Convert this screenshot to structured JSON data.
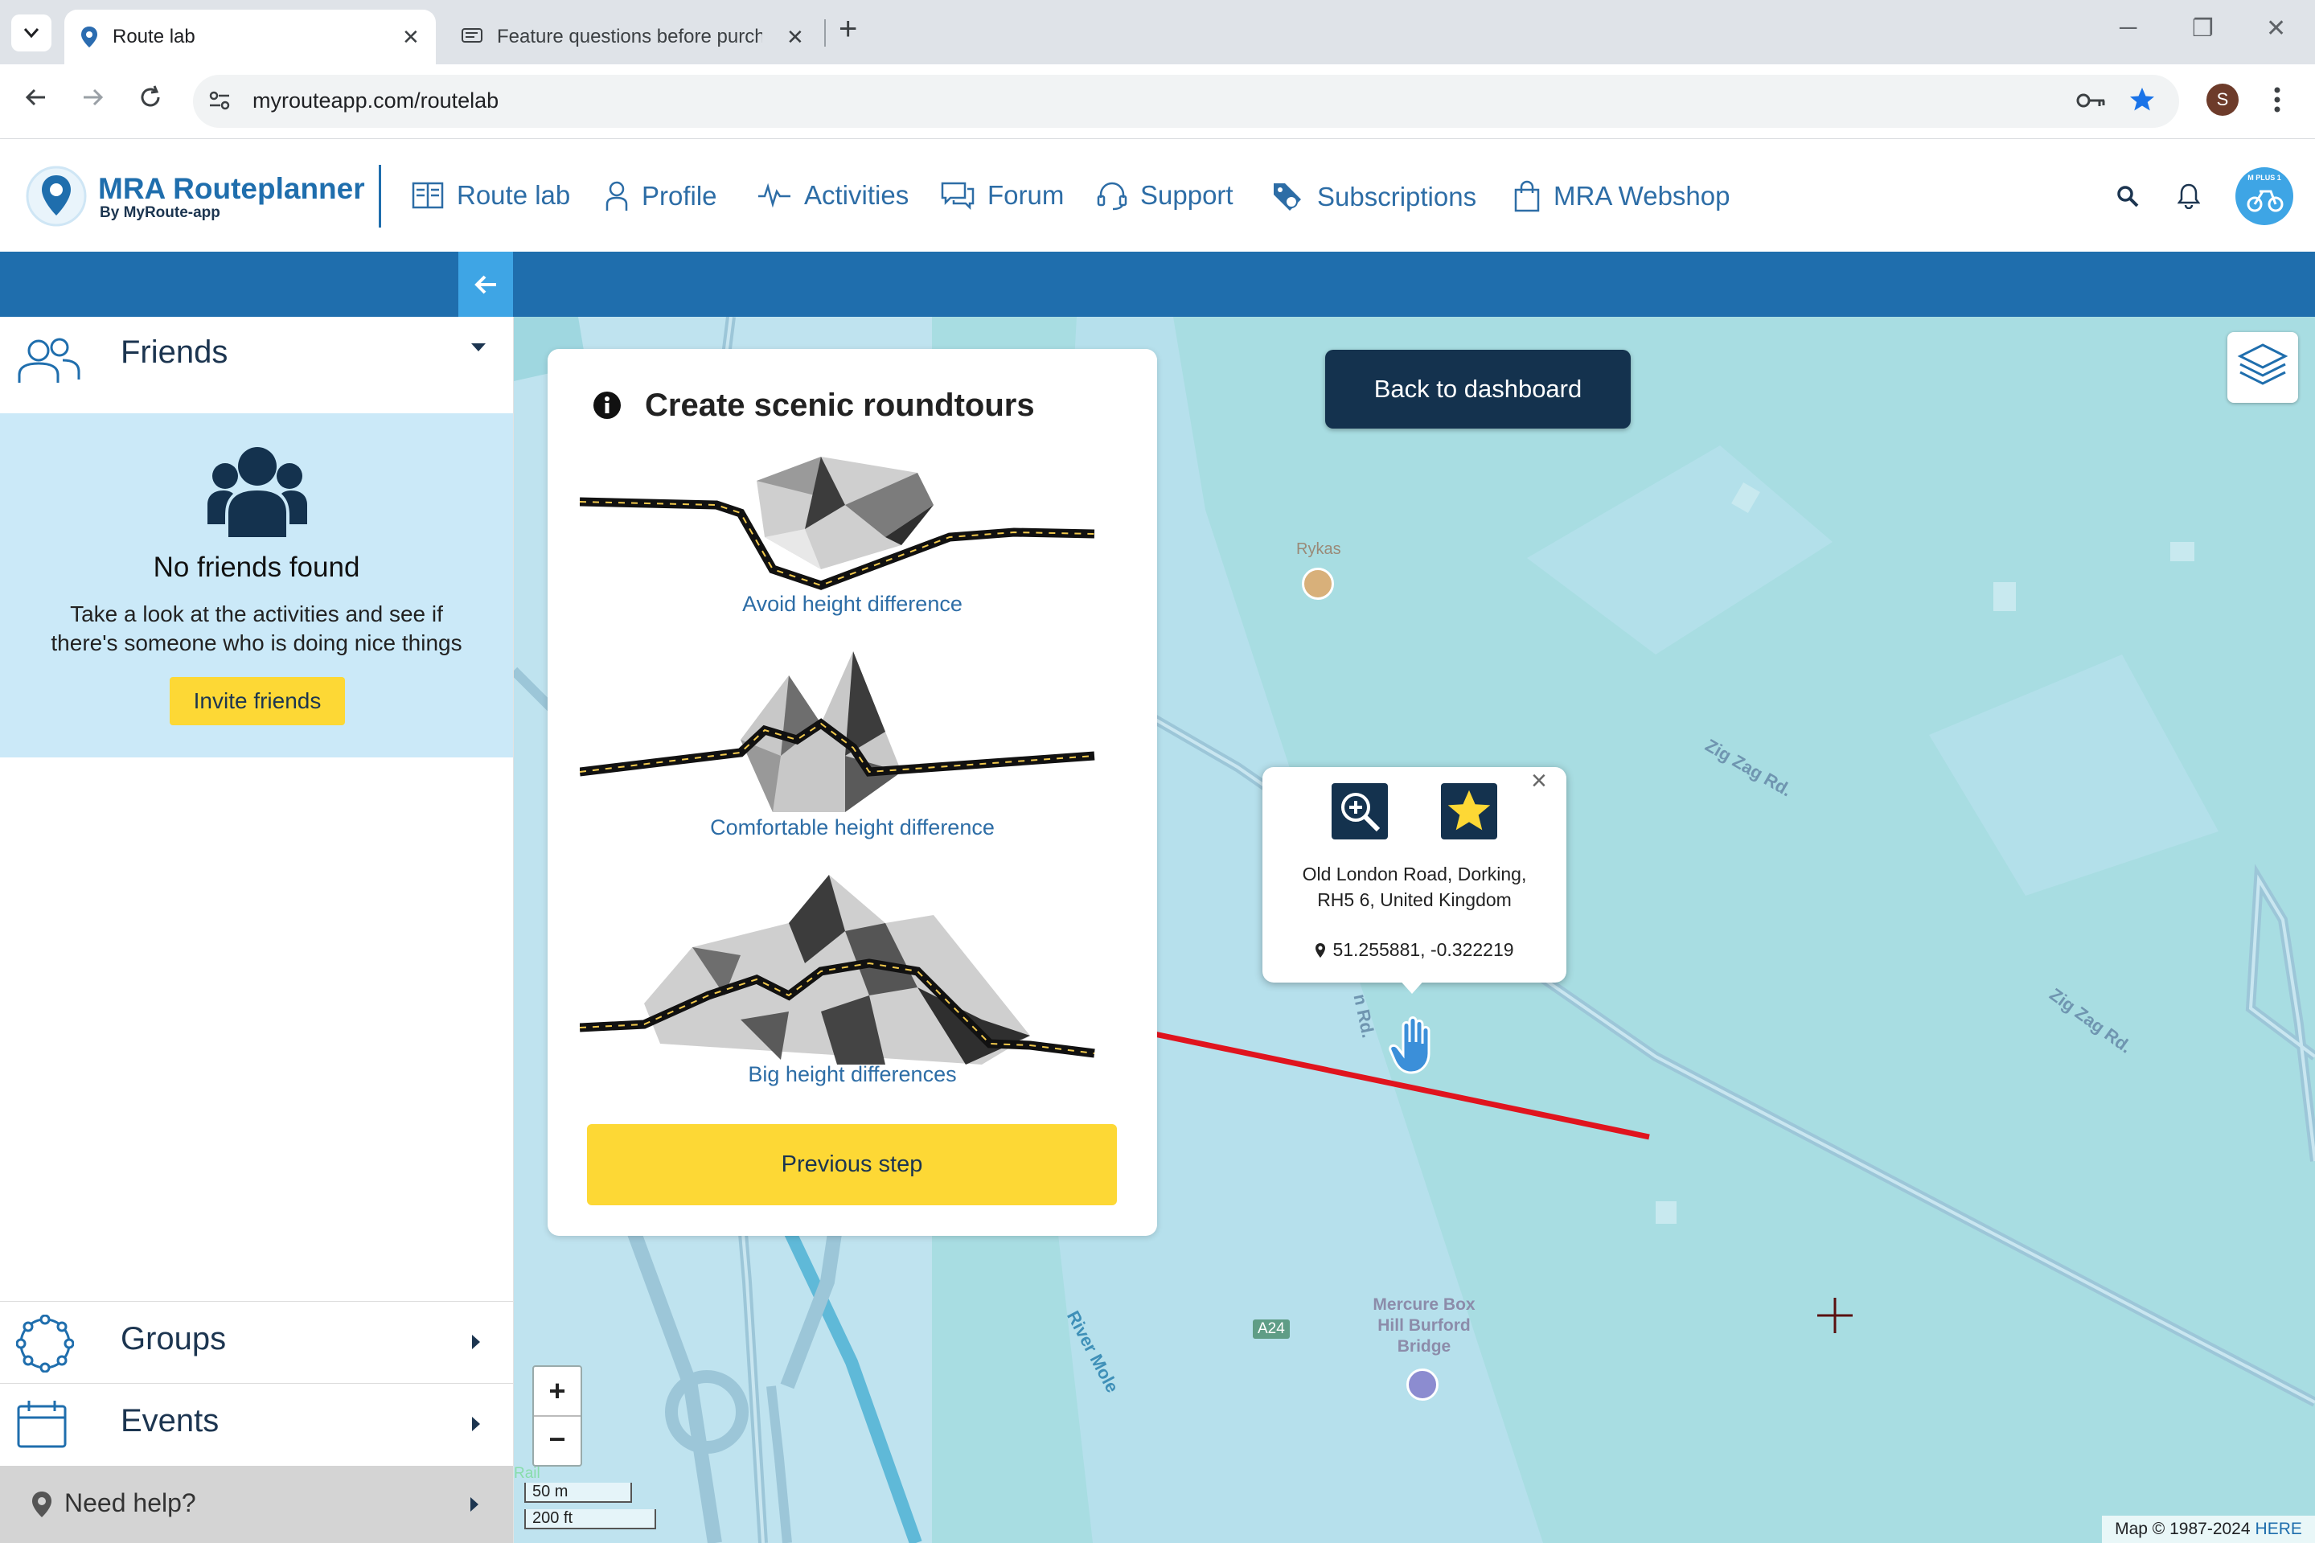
{
  "browser": {
    "tabs": [
      {
        "title": "Route lab",
        "close": "✕"
      },
      {
        "title": "Feature questions before purch",
        "close": "✕"
      }
    ],
    "new_tab": "+",
    "url": "myrouteapp.com/routelab",
    "profile_initial": "S",
    "window_controls": {
      "minimize": "─",
      "restore": "❐",
      "close": "✕"
    }
  },
  "app": {
    "logo": {
      "title": "MRA Routeplanner",
      "subtitle": "By MyRoute-app"
    },
    "nav": [
      {
        "label": "Route lab",
        "icon": "map-book-icon"
      },
      {
        "label": "Profile",
        "icon": "user-icon"
      },
      {
        "label": "Activities",
        "icon": "pulse-icon"
      },
      {
        "label": "Forum",
        "icon": "chat-icon"
      },
      {
        "label": "Support",
        "icon": "headset-icon"
      },
      {
        "label": "Subscriptions",
        "icon": "tag-icon"
      },
      {
        "label": "MRA Webshop",
        "icon": "bag-icon"
      }
    ],
    "badge_text": "M PLUS 1"
  },
  "sidebar": {
    "friends": {
      "heading": "Friends",
      "empty_title": "No friends found",
      "empty_text_line1": "Take a look at the activities and see if",
      "empty_text_line2": "there's someone who is doing nice things",
      "invite_button": "Invite friends"
    },
    "groups": {
      "heading": "Groups"
    },
    "events": {
      "heading": "Events"
    },
    "help": {
      "label": "Need help?"
    }
  },
  "panel": {
    "title": "Create scenic roundtours",
    "options": [
      {
        "label": "Avoid height difference"
      },
      {
        "label": "Comfortable height difference"
      },
      {
        "label": "Big height differences"
      }
    ],
    "previous_button": "Previous step"
  },
  "map": {
    "back_button": "Back to dashboard",
    "popup": {
      "address_line1": "Old London Road, Dorking,",
      "address_line2": "RH5 6, United Kingdom",
      "coordinates": "51.255881, -0.322219",
      "close": "×"
    },
    "labels": {
      "rykas": "Rykas",
      "zigzag1": "Zig Zag Rd.",
      "zigzag2": "Zig Zag Rd.",
      "river": "River Mole",
      "road": "A24",
      "hotel_line1": "Mercure Box",
      "hotel_line2": "Hill Burford",
      "hotel_line3": "Bridge",
      "rail": "Rail",
      "road_partial": "n Rd."
    },
    "zoom_in": "+",
    "zoom_out": "−",
    "scale_m": "50 m",
    "scale_ft": "200 ft",
    "attribution": "Map © 1987-2024",
    "attribution_link": "HERE"
  },
  "colors": {
    "brand_blue": "#1f6ead",
    "accent_light_blue": "#3ea5e5",
    "navy": "#14324e",
    "yellow": "#fdd835",
    "map_water": "#a8dde2",
    "annotation_red": "#e0141e"
  }
}
